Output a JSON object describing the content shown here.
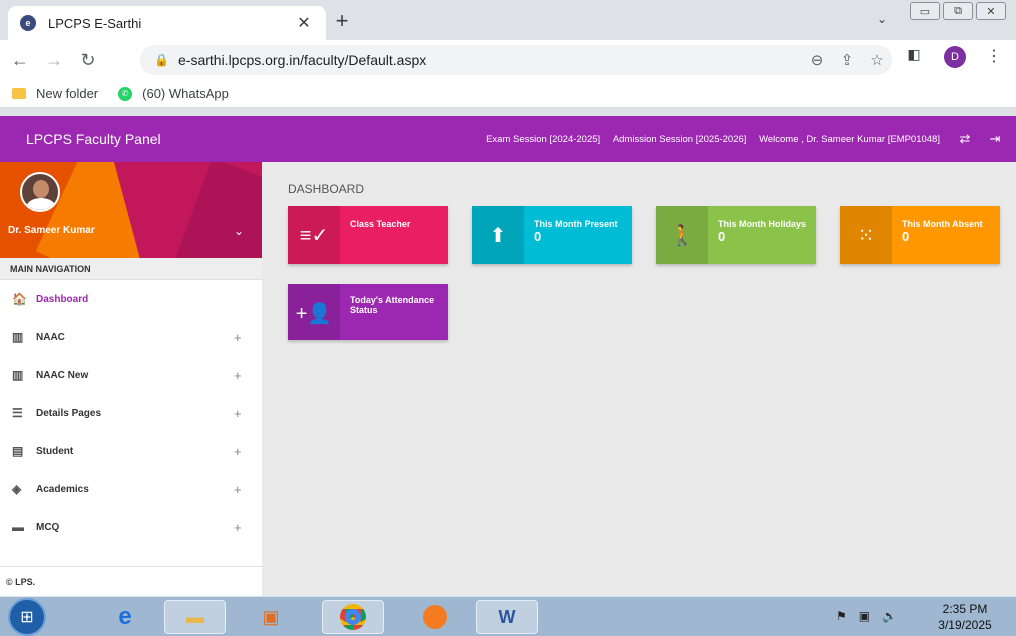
{
  "browser": {
    "tab_title": "LPCPS E-Sarthi",
    "tab_favicon_letter": "e",
    "new_tab_symbol": "+",
    "url": "e-sarthi.lpcps.org.in/faculty/Default.aspx",
    "profile_initial": "D",
    "bookmarks": [
      {
        "label": "New folder",
        "icon": "folder-icon"
      },
      {
        "label": "(60) WhatsApp",
        "icon": "whatsapp-icon"
      }
    ]
  },
  "app": {
    "title": "LPCPS Faculty Panel",
    "exam_session": "Exam Session [2024-2025]",
    "admission_session": "Admission Session [2025-2026]",
    "welcome": "Welcome , Dr. Sameer Kumar [EMP01048]",
    "accent_color": "#9c27b0"
  },
  "sidebar": {
    "user_name": "Dr. Sameer Kumar",
    "nav_header": "MAIN NAVIGATION",
    "items": [
      {
        "label": "Dashboard",
        "icon": "home-icon",
        "expandable": false,
        "active": true
      },
      {
        "label": "NAAC",
        "icon": "map-icon",
        "expandable": true
      },
      {
        "label": "NAAC New",
        "icon": "map-icon",
        "expandable": true
      },
      {
        "label": "Details Pages",
        "icon": "list-icon",
        "expandable": true
      },
      {
        "label": "Student",
        "icon": "clipboard-icon",
        "expandable": true
      },
      {
        "label": "Academics",
        "icon": "layers-icon",
        "expandable": true
      },
      {
        "label": "MCQ",
        "icon": "message-icon",
        "expandable": true
      }
    ],
    "expand_symbol": "+",
    "footer": "© LPS."
  },
  "dashboard": {
    "title": "DASHBOARD",
    "cards": [
      {
        "label": "Class Teacher",
        "value": "",
        "icon": "checklist-icon",
        "color": "#e91e63"
      },
      {
        "label": "This Month Present",
        "value": "0",
        "icon": "upload-box-icon",
        "color": "#00bcd4"
      },
      {
        "label": "This Month Holidays",
        "value": "0",
        "icon": "person-walking-icon",
        "color": "#8bc34a"
      },
      {
        "label": "This Month Absent",
        "value": "0",
        "icon": "grid-off-icon",
        "color": "#ff9800"
      },
      {
        "label": "Today's Attendance Status",
        "value": "",
        "icon": "add-person-icon",
        "color": "#9c27b0"
      }
    ]
  },
  "taskbar": {
    "time": "2:35 PM",
    "date": "3/19/2025"
  }
}
